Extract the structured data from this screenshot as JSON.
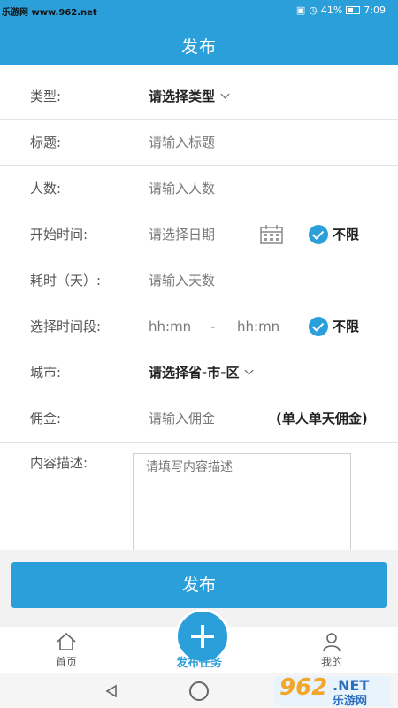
{
  "status_bar": {
    "watermark": "乐游网 www.962.net",
    "battery_pct": "41%",
    "time": "7:09"
  },
  "header": {
    "title": "发布"
  },
  "form": {
    "type_label": "类型:",
    "type_value": "请选择类型",
    "title_label": "标题:",
    "title_placeholder": "请输入标题",
    "people_label": "人数:",
    "people_placeholder": "请输入人数",
    "start_label": "开始时间:",
    "start_placeholder": "请选择日期",
    "start_unlimited": "不限",
    "duration_label": "耗时（天）:",
    "duration_placeholder": "请输入天数",
    "period_label": "选择时间段:",
    "period_start": "hh:mn",
    "period_sep": "-",
    "period_end": "hh:mn",
    "period_unlimited": "不限",
    "city_label": "城市:",
    "city_value": "请选择省-市-区",
    "commission_label": "佣金:",
    "commission_placeholder": "请输入佣金",
    "commission_note": "(单人单天佣金)",
    "desc_label": "内容描述:",
    "desc_placeholder": "请填写内容描述"
  },
  "publish_button": "发布",
  "tabbar": {
    "home": "首页",
    "publish_task": "发布任务",
    "mine": "我的"
  },
  "watermark_logo": {
    "big": "962",
    "net": ".NET",
    "cn": "乐游网"
  },
  "colors": {
    "accent": "#2b9fd9"
  }
}
